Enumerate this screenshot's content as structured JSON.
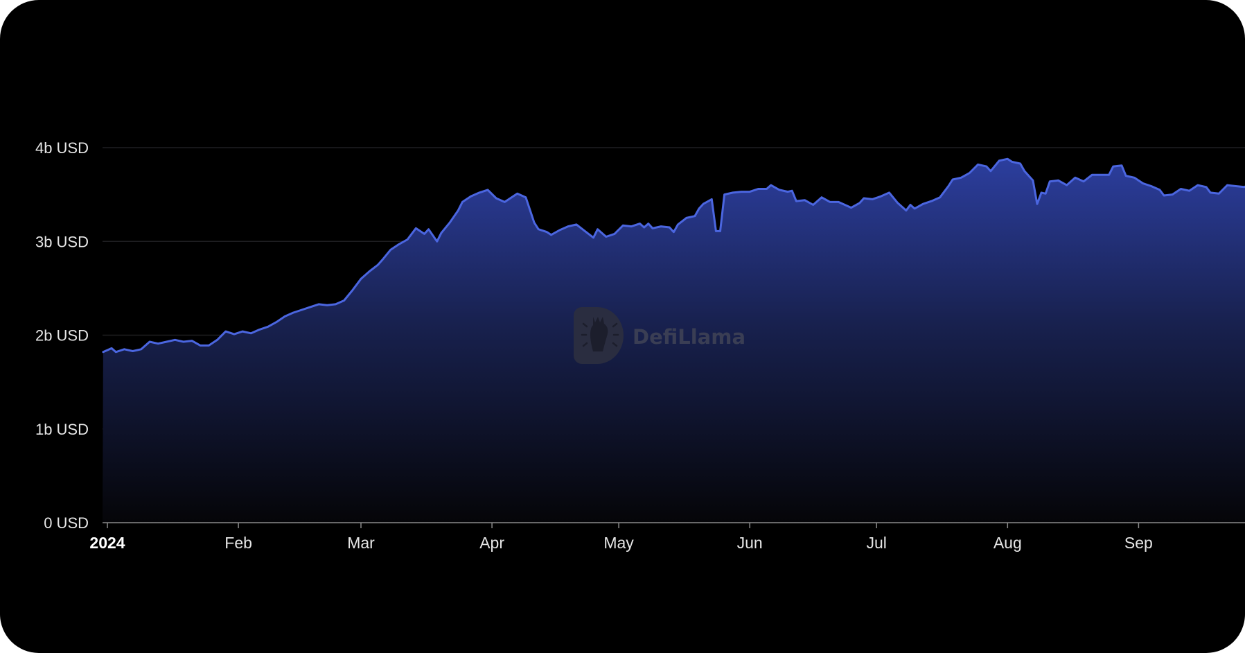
{
  "watermark": {
    "text": "DefiLlama",
    "icon": "llama-logo-icon"
  },
  "colors": {
    "background": "#000000",
    "line": "#4b66e0",
    "area_top": "#2c3e9e",
    "area_bottom": "#050508",
    "grid": "#1f1f22",
    "tick_text": "#e6e6e6"
  },
  "chart_data": {
    "type": "area",
    "title": "",
    "xlabel": "",
    "ylabel": "",
    "ylim": [
      0,
      4.0
    ],
    "yticks": [
      {
        "value": 0,
        "label": "0 USD"
      },
      {
        "value": 1,
        "label": "1b USD"
      },
      {
        "value": 2,
        "label": "2b USD"
      },
      {
        "value": 3,
        "label": "3b USD"
      },
      {
        "value": 4,
        "label": "4b USD"
      }
    ],
    "xticks": [
      {
        "date": "2024-01-01",
        "label": "2024",
        "bold": true
      },
      {
        "date": "2024-02-01",
        "label": "Feb"
      },
      {
        "date": "2024-03-01",
        "label": "Mar"
      },
      {
        "date": "2024-04-01",
        "label": "Apr"
      },
      {
        "date": "2024-05-01",
        "label": "May"
      },
      {
        "date": "2024-06-01",
        "label": "Jun"
      },
      {
        "date": "2024-07-01",
        "label": "Jul"
      },
      {
        "date": "2024-08-01",
        "label": "Aug"
      },
      {
        "date": "2024-09-01",
        "label": "Sep"
      }
    ],
    "grid": true,
    "units": "billion USD",
    "series": [
      {
        "points": [
          [
            "2023-12-31",
            1.82
          ],
          [
            "2024-01-02",
            1.86
          ],
          [
            "2024-01-03",
            1.82
          ],
          [
            "2024-01-05",
            1.85
          ],
          [
            "2024-01-07",
            1.83
          ],
          [
            "2024-01-09",
            1.85
          ],
          [
            "2024-01-11",
            1.93
          ],
          [
            "2024-01-13",
            1.91
          ],
          [
            "2024-01-15",
            1.93
          ],
          [
            "2024-01-17",
            1.95
          ],
          [
            "2024-01-19",
            1.93
          ],
          [
            "2024-01-21",
            1.94
          ],
          [
            "2024-01-23",
            1.89
          ],
          [
            "2024-01-25",
            1.89
          ],
          [
            "2024-01-27",
            1.95
          ],
          [
            "2024-01-29",
            2.04
          ],
          [
            "2024-01-31",
            2.01
          ],
          [
            "2024-02-02",
            2.04
          ],
          [
            "2024-02-04",
            2.02
          ],
          [
            "2024-02-06",
            2.06
          ],
          [
            "2024-02-08",
            2.09
          ],
          [
            "2024-02-10",
            2.14
          ],
          [
            "2024-02-12",
            2.2
          ],
          [
            "2024-02-14",
            2.24
          ],
          [
            "2024-02-16",
            2.27
          ],
          [
            "2024-02-18",
            2.3
          ],
          [
            "2024-02-20",
            2.33
          ],
          [
            "2024-02-22",
            2.32
          ],
          [
            "2024-02-24",
            2.33
          ],
          [
            "2024-02-26",
            2.37
          ],
          [
            "2024-02-28",
            2.48
          ],
          [
            "2024-03-01",
            2.6
          ],
          [
            "2024-03-03",
            2.68
          ],
          [
            "2024-03-05",
            2.75
          ],
          [
            "2024-03-06",
            2.8
          ],
          [
            "2024-03-08",
            2.91
          ],
          [
            "2024-03-10",
            2.97
          ],
          [
            "2024-03-12",
            3.02
          ],
          [
            "2024-03-14",
            3.14
          ],
          [
            "2024-03-16",
            3.08
          ],
          [
            "2024-03-17",
            3.13
          ],
          [
            "2024-03-19",
            3.0
          ],
          [
            "2024-03-20",
            3.09
          ],
          [
            "2024-03-22",
            3.2
          ],
          [
            "2024-03-24",
            3.33
          ],
          [
            "2024-03-25",
            3.42
          ],
          [
            "2024-03-27",
            3.48
          ],
          [
            "2024-03-29",
            3.52
          ],
          [
            "2024-03-31",
            3.55
          ],
          [
            "2024-04-02",
            3.46
          ],
          [
            "2024-04-04",
            3.42
          ],
          [
            "2024-04-06",
            3.48
          ],
          [
            "2024-04-07",
            3.51
          ],
          [
            "2024-04-09",
            3.47
          ],
          [
            "2024-04-11",
            3.2
          ],
          [
            "2024-04-12",
            3.13
          ],
          [
            "2024-04-14",
            3.1
          ],
          [
            "2024-04-15",
            3.07
          ],
          [
            "2024-04-17",
            3.12
          ],
          [
            "2024-04-19",
            3.16
          ],
          [
            "2024-04-21",
            3.18
          ],
          [
            "2024-04-23",
            3.11
          ],
          [
            "2024-04-25",
            3.04
          ],
          [
            "2024-04-26",
            3.13
          ],
          [
            "2024-04-28",
            3.05
          ],
          [
            "2024-04-30",
            3.08
          ],
          [
            "2024-05-02",
            3.17
          ],
          [
            "2024-05-04",
            3.16
          ],
          [
            "2024-05-06",
            3.19
          ],
          [
            "2024-05-07",
            3.15
          ],
          [
            "2024-05-08",
            3.19
          ],
          [
            "2024-05-09",
            3.14
          ],
          [
            "2024-05-11",
            3.16
          ],
          [
            "2024-05-13",
            3.15
          ],
          [
            "2024-05-14",
            3.1
          ],
          [
            "2024-05-15",
            3.18
          ],
          [
            "2024-05-17",
            3.25
          ],
          [
            "2024-05-19",
            3.27
          ],
          [
            "2024-05-20",
            3.35
          ],
          [
            "2024-05-21",
            3.4
          ],
          [
            "2024-05-23",
            3.45
          ],
          [
            "2024-05-24",
            3.11
          ],
          [
            "2024-05-25",
            3.11
          ],
          [
            "2024-05-26",
            3.5
          ],
          [
            "2024-05-28",
            3.52
          ],
          [
            "2024-05-30",
            3.53
          ],
          [
            "2024-06-01",
            3.53
          ],
          [
            "2024-06-03",
            3.56
          ],
          [
            "2024-06-05",
            3.56
          ],
          [
            "2024-06-06",
            3.6
          ],
          [
            "2024-06-08",
            3.55
          ],
          [
            "2024-06-10",
            3.53
          ],
          [
            "2024-06-11",
            3.54
          ],
          [
            "2024-06-12",
            3.43
          ],
          [
            "2024-06-14",
            3.44
          ],
          [
            "2024-06-16",
            3.39
          ],
          [
            "2024-06-18",
            3.47
          ],
          [
            "2024-06-20",
            3.42
          ],
          [
            "2024-06-22",
            3.42
          ],
          [
            "2024-06-24",
            3.38
          ],
          [
            "2024-06-25",
            3.36
          ],
          [
            "2024-06-27",
            3.41
          ],
          [
            "2024-06-28",
            3.46
          ],
          [
            "2024-06-30",
            3.45
          ],
          [
            "2024-07-02",
            3.48
          ],
          [
            "2024-07-04",
            3.52
          ],
          [
            "2024-07-06",
            3.41
          ],
          [
            "2024-07-08",
            3.33
          ],
          [
            "2024-07-09",
            3.39
          ],
          [
            "2024-07-10",
            3.35
          ],
          [
            "2024-07-12",
            3.4
          ],
          [
            "2024-07-14",
            3.43
          ],
          [
            "2024-07-16",
            3.47
          ],
          [
            "2024-07-18",
            3.59
          ],
          [
            "2024-07-19",
            3.66
          ],
          [
            "2024-07-21",
            3.68
          ],
          [
            "2024-07-23",
            3.73
          ],
          [
            "2024-07-25",
            3.82
          ],
          [
            "2024-07-27",
            3.8
          ],
          [
            "2024-07-28",
            3.75
          ],
          [
            "2024-07-30",
            3.86
          ],
          [
            "2024-08-01",
            3.88
          ],
          [
            "2024-08-02",
            3.85
          ],
          [
            "2024-08-04",
            3.83
          ],
          [
            "2024-08-05",
            3.75
          ],
          [
            "2024-08-07",
            3.65
          ],
          [
            "2024-08-08",
            3.4
          ],
          [
            "2024-08-09",
            3.52
          ],
          [
            "2024-08-10",
            3.51
          ],
          [
            "2024-08-11",
            3.64
          ],
          [
            "2024-08-13",
            3.65
          ],
          [
            "2024-08-15",
            3.6
          ],
          [
            "2024-08-17",
            3.68
          ],
          [
            "2024-08-19",
            3.64
          ],
          [
            "2024-08-21",
            3.71
          ],
          [
            "2024-08-23",
            3.71
          ],
          [
            "2024-08-25",
            3.71
          ],
          [
            "2024-08-26",
            3.8
          ],
          [
            "2024-08-28",
            3.81
          ],
          [
            "2024-08-29",
            3.7
          ],
          [
            "2024-08-31",
            3.68
          ],
          [
            "2024-09-02",
            3.62
          ],
          [
            "2024-09-04",
            3.59
          ],
          [
            "2024-09-06",
            3.55
          ],
          [
            "2024-09-07",
            3.49
          ],
          [
            "2024-09-09",
            3.5
          ],
          [
            "2024-09-11",
            3.56
          ],
          [
            "2024-09-13",
            3.54
          ],
          [
            "2024-09-15",
            3.6
          ],
          [
            "2024-09-17",
            3.58
          ],
          [
            "2024-09-18",
            3.52
          ],
          [
            "2024-09-20",
            3.51
          ],
          [
            "2024-09-22",
            3.6
          ],
          [
            "2024-09-24",
            3.59
          ],
          [
            "2024-09-26",
            3.58
          ],
          [
            "2024-09-27",
            3.6
          ],
          [
            "2024-09-28",
            3.57
          ]
        ]
      }
    ]
  }
}
